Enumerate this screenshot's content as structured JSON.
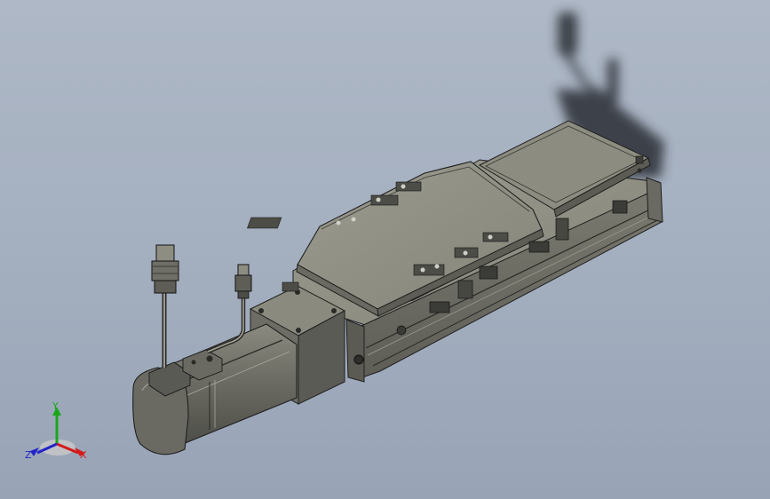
{
  "viewport": {
    "background_top": "#aeb8c6",
    "background_bottom": "#98a4b6",
    "model": "linear-actuator-stage-with-servo-motor"
  },
  "colors": {
    "body_top": "#8f8f83",
    "body_side": "#6e6e66",
    "body_dark": "#4f4f4a",
    "edge": "#1f1f1f",
    "shadow": "#3b3e44"
  },
  "triad": {
    "x_label": "X",
    "y_label": "Y",
    "z_label": "Z",
    "x_color": "#d41a1a",
    "y_color": "#1aa61a",
    "z_color": "#2323c8"
  }
}
